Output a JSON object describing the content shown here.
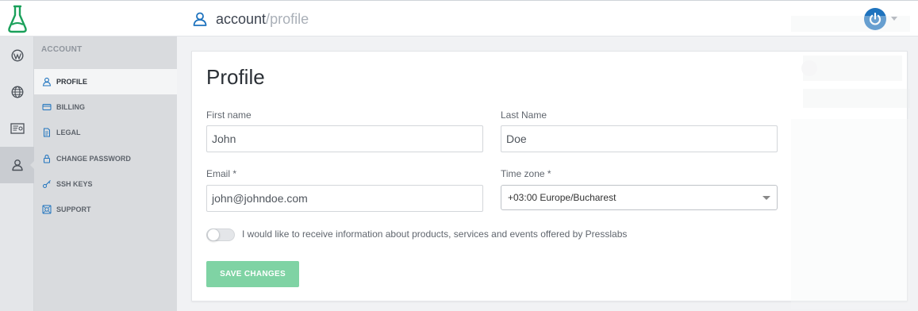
{
  "topbar": {
    "breadcrumb_section": "account",
    "breadcrumb_separator": "/",
    "breadcrumb_page": "profile",
    "brand_color": "#1aa05a",
    "accent_color": "#1e73be"
  },
  "rail": {
    "items": [
      {
        "icon": "wordpress-icon"
      },
      {
        "icon": "globe-icon"
      },
      {
        "icon": "certificate-icon"
      },
      {
        "icon": "user-icon",
        "active": true
      }
    ]
  },
  "subnav": {
    "title": "ACCOUNT",
    "items": [
      {
        "label": "PROFILE",
        "icon": "user-icon",
        "active": true
      },
      {
        "label": "BILLING",
        "icon": "wallet-icon"
      },
      {
        "label": "LEGAL",
        "icon": "document-icon"
      },
      {
        "label": "CHANGE PASSWORD",
        "icon": "lock-icon"
      },
      {
        "label": "SSH KEYS",
        "icon": "key-icon"
      },
      {
        "label": "SUPPORT",
        "icon": "lifebuoy-icon"
      }
    ]
  },
  "form": {
    "title": "Profile",
    "first_name": {
      "label": "First name",
      "value": "John"
    },
    "last_name": {
      "label": "Last Name",
      "value": "Doe"
    },
    "email": {
      "label": "Email *",
      "value": "john@johndoe.com"
    },
    "timezone": {
      "label": "Time zone *",
      "value": "+03:00 Europe/Bucharest"
    },
    "newsletter": {
      "label": "I would like to receive information about products, services and events offered by Presslabs",
      "checked": false
    },
    "save_label": "SAVE CHANGES",
    "save_color": "#7fd3a4"
  }
}
